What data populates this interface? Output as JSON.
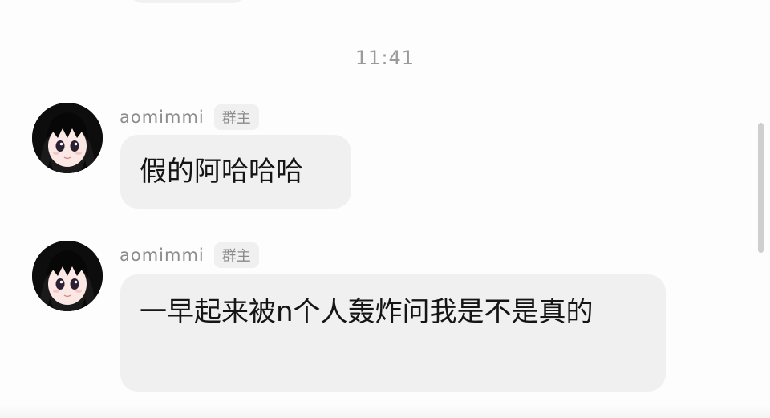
{
  "chat": {
    "timestamp": "11:41",
    "messages": [
      {
        "sender": "aomimmi",
        "role": "群主",
        "text": "假的阿哈哈哈"
      },
      {
        "sender": "aomimmi",
        "role": "群主",
        "text": "一早起来被n个人轰炸问我是不是真的"
      }
    ]
  },
  "avatar_icon": "anime-girl-avatar-icon",
  "colors": {
    "bubble": "#f0f0f0",
    "timestamp": "#9a9a9a",
    "sender_name": "#8c8c8c"
  }
}
